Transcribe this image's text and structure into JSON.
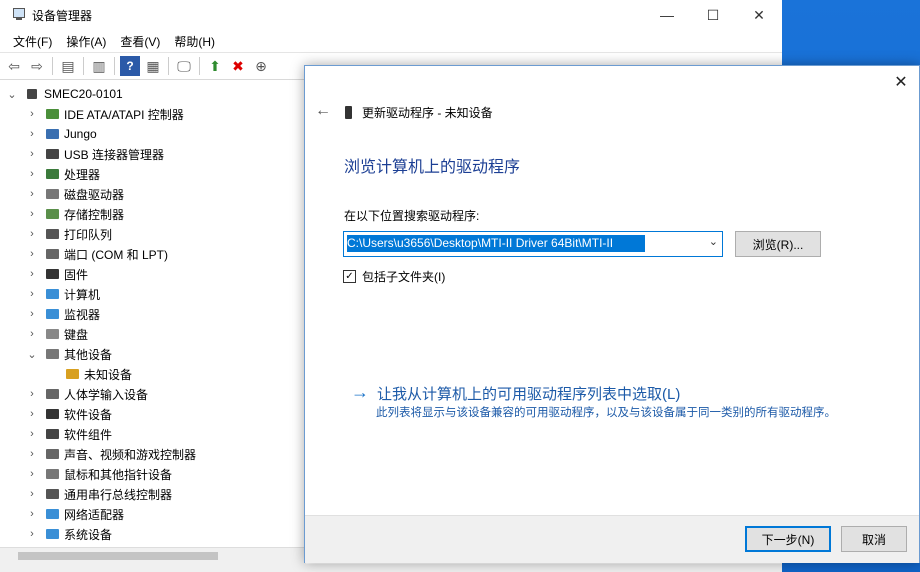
{
  "window": {
    "title": "设备管理器",
    "minimize": "—",
    "maximize": "☐",
    "close": "✕"
  },
  "menu": [
    "文件(F)",
    "操作(A)",
    "查看(V)",
    "帮助(H)"
  ],
  "tree": {
    "root": "SMEC20-0101",
    "nodes": [
      {
        "label": "IDE ATA/ATAPI 控制器",
        "expanded": false,
        "color": "#4a8f3a"
      },
      {
        "label": "Jungo",
        "expanded": false,
        "color": "#3a6fb0"
      },
      {
        "label": "USB 连接器管理器",
        "expanded": false,
        "color": "#444444"
      },
      {
        "label": "处理器",
        "expanded": false,
        "color": "#3b7a3b"
      },
      {
        "label": "磁盘驱动器",
        "expanded": false,
        "color": "#777777"
      },
      {
        "label": "存储控制器",
        "expanded": false,
        "color": "#5a8f4a"
      },
      {
        "label": "打印队列",
        "expanded": false,
        "color": "#555555"
      },
      {
        "label": "端口 (COM 和 LPT)",
        "expanded": false,
        "color": "#666666"
      },
      {
        "label": "固件",
        "expanded": false,
        "color": "#333333"
      },
      {
        "label": "计算机",
        "expanded": false,
        "color": "#3a8fd6"
      },
      {
        "label": "监视器",
        "expanded": false,
        "color": "#3a8fd6"
      },
      {
        "label": "键盘",
        "expanded": false,
        "color": "#888888"
      },
      {
        "label": "其他设备",
        "expanded": true,
        "color": "#777777"
      },
      {
        "label": "未知设备",
        "child": true,
        "color": "#d8a020"
      },
      {
        "label": "人体学输入设备",
        "expanded": false,
        "color": "#666666"
      },
      {
        "label": "软件设备",
        "expanded": false,
        "color": "#333333"
      },
      {
        "label": "软件组件",
        "expanded": false,
        "color": "#444444"
      },
      {
        "label": "声音、视频和游戏控制器",
        "expanded": false,
        "color": "#666666"
      },
      {
        "label": "鼠标和其他指针设备",
        "expanded": false,
        "color": "#777777"
      },
      {
        "label": "通用串行总线控制器",
        "expanded": false,
        "color": "#555555"
      },
      {
        "label": "网络适配器",
        "expanded": false,
        "color": "#3a8fd6"
      },
      {
        "label": "系统设备",
        "expanded": false,
        "color": "#3a8fd6"
      }
    ]
  },
  "dialog": {
    "breadcrumb": "更新驱动程序 - 未知设备",
    "heading": "浏览计算机上的驱动程序",
    "search_label": "在以下位置搜索驱动程序:",
    "path_value": "C:\\Users\\u3656\\Desktop\\MTI-II Driver 64Bit\\MTI-II",
    "browse_label": "浏览(R)...",
    "include_subfolders_label": "包括子文件夹(I)",
    "include_subfolders_checked": true,
    "pick_link": "让我从计算机上的可用驱动程序列表中选取(L)",
    "pick_desc": "此列表将显示与该设备兼容的可用驱动程序，以及与该设备属于同一类别的所有驱动程序。",
    "next_label": "下一步(N)",
    "cancel_label": "取消"
  }
}
